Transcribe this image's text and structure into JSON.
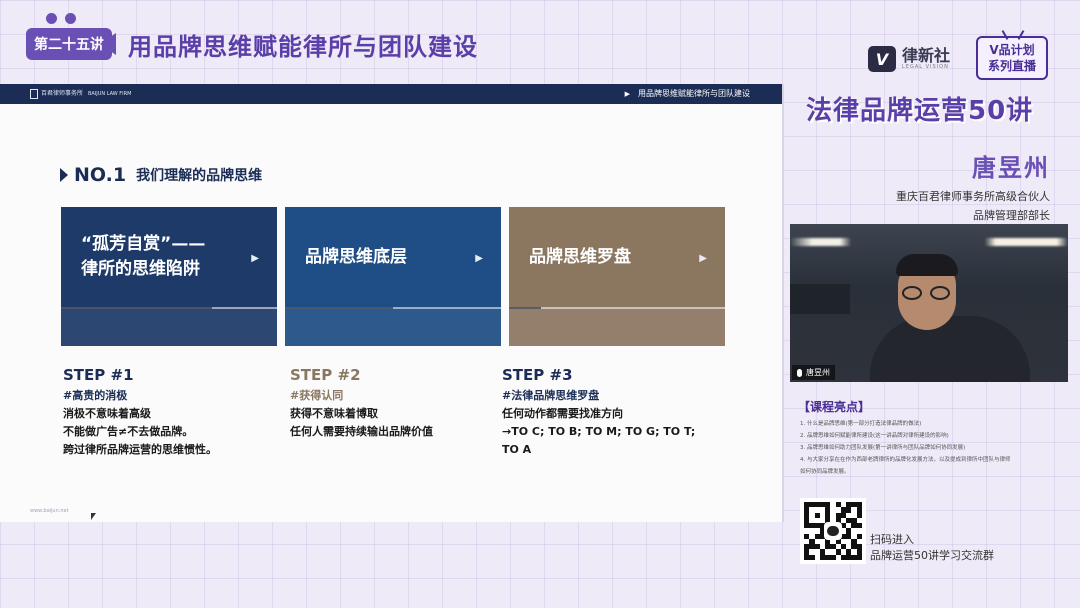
{
  "header": {
    "lecture_badge": "第二十五讲",
    "lecture_title": "用品牌思维赋能律所与团队建设"
  },
  "slide": {
    "topbar_logo": "百君律师事务所",
    "topbar_logo_sub": "BAIJUN LAW FIRM",
    "topbar_crumb": "用品牌思维赋能律所与团队建设",
    "section_no": "NO.1",
    "section_title": "我们理解的品牌思维",
    "cards": [
      {
        "line1": "“孤芳自赏”——",
        "line2": "律所的思维陷阱",
        "color": "#1d3a68",
        "progress": 0.7
      },
      {
        "line1": "品牌思维底层",
        "line2": "",
        "color": "#1f4d85",
        "progress": 0.5
      },
      {
        "line1": "品牌思维罗盘",
        "line2": "",
        "color": "#8b7660",
        "progress": 0.15
      }
    ],
    "steps": [
      {
        "label": "STEP #1",
        "head": "#高贵的消极",
        "lines": [
          "消极不意味着高级",
          "不能做广告≠不去做品牌。",
          "跨过律所品牌运营的思维惯性。"
        ]
      },
      {
        "label": "STEP #2",
        "head": "#获得认同",
        "lines": [
          "获得不意味着博取",
          "任何人需要持续输出品牌价值",
          ""
        ]
      },
      {
        "label": "STEP #3",
        "head": "#法律品牌思维罗盘",
        "lines": [
          "任何动作都需要找准方向",
          "→TO C; TO B; TO M; TO G; TO T; TO A",
          ""
        ]
      }
    ],
    "url": "www.baijun.net"
  },
  "sidebar": {
    "brand_mark": "V",
    "brand_name": "律新社",
    "brand_sub": "LEGAL VISION",
    "vplan_line1": "V品计划",
    "vplan_line2": "系列直播",
    "series_title": "法律品牌运营50讲",
    "speaker_name": "唐昱州",
    "speaker_title1": "重庆百君律师事务所高级合伙人",
    "speaker_title2": "品牌管理部部长",
    "video_label": "唐昱州",
    "highlights_title": "【课程亮点】",
    "highlights": [
      "1. 什么是品牌思维(第一部分打造法律品牌的做法)",
      "2. 品牌思维如何赋能律所建设(这一讲品牌对律所建设的影响)",
      "3. 品牌思维如何助力团队发展(第一讲律所与团队品牌如何协同发展)",
      "4. 与大家分享在在作为西部老牌律所的品牌化发展方法，以及提成到律所中团队与律师",
      "   如何协同品牌发展。"
    ],
    "qr_text_1": "扫码进入",
    "qr_text_2": "品牌运营50讲学习交流群"
  }
}
